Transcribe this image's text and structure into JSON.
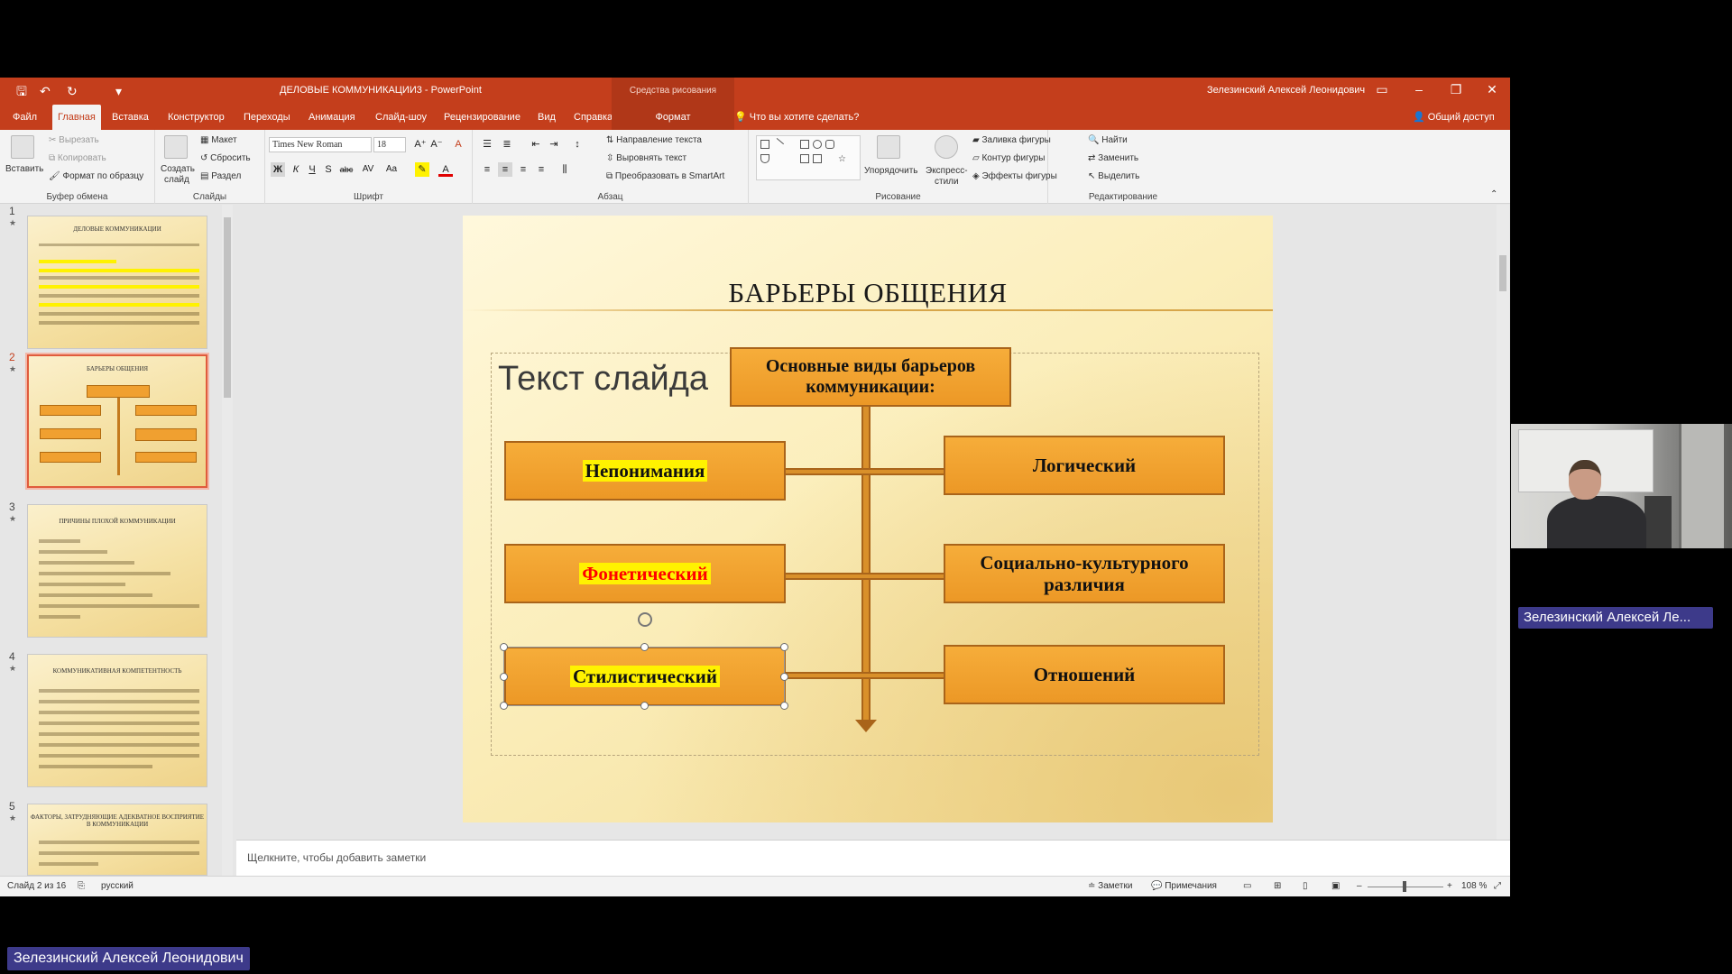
{
  "window": {
    "title": "ДЕЛОВЫЕ КОММУНИКАЦИИ3  -  PowerPoint",
    "context_group": "Средства рисования",
    "user": "Зелезинский Алексей Леонидович",
    "controls": {
      "ribbon_display": "▭",
      "minimize": "–",
      "restore": "❐",
      "close": "✕"
    }
  },
  "quick_access": {
    "save": "🖫",
    "undo": "↶",
    "redo": "↻",
    "customize": "▾"
  },
  "tabs": [
    "Файл",
    "Главная",
    "Вставка",
    "Конструктор",
    "Переходы",
    "Анимация",
    "Слайд-шоу",
    "Рецензирование",
    "Вид",
    "Справка",
    "Формат"
  ],
  "active_tab": "Главная",
  "tell_me": "Что вы хотите сделать?",
  "share": "Общий доступ",
  "ribbon": {
    "clipboard": {
      "paste": "Вставить",
      "cut": "Вырезать",
      "copy": "Копировать",
      "format_painter": "Формат по образцу",
      "label": "Буфер обмена"
    },
    "slides": {
      "new_slide_1": "Создать",
      "new_slide_2": "слайд",
      "layout": "Макет",
      "reset": "Сбросить",
      "section": "Раздел",
      "label": "Слайды"
    },
    "font": {
      "name": "Times New Roman",
      "size": "18",
      "bold": "Ж",
      "italic": "К",
      "underline": "Ч",
      "shadow": "S",
      "strike": "abc",
      "spacing": "AV",
      "case": "Aa",
      "color": "A",
      "grow": "A⁺",
      "shrink": "A⁻",
      "clear": "A",
      "label": "Шрифт"
    },
    "paragraph": {
      "text_direction": "Направление текста",
      "align_text": "Выровнять текст",
      "smartart": "Преобразовать в SmartArt",
      "label": "Абзац"
    },
    "drawing": {
      "arrange": "Упорядочить",
      "quick_styles_1": "Экспресс-",
      "quick_styles_2": "стили",
      "fill": "Заливка фигуры",
      "outline": "Контур фигуры",
      "effects": "Эффекты фигуры",
      "label": "Рисование"
    },
    "editing": {
      "find": "Найти",
      "replace": "Заменить",
      "select": "Выделить",
      "label": "Редактирование"
    }
  },
  "thumbnails": [
    {
      "num": "1",
      "title": "ДЕЛОВЫЕ КОММУНИКАЦИИ"
    },
    {
      "num": "2",
      "title": "БАРЬЕРЫ ОБЩЕНИЯ",
      "selected": true
    },
    {
      "num": "3",
      "title": "ПРИЧИНЫ ПЛОХОЙ КОММУНИКАЦИИ"
    },
    {
      "num": "4",
      "title": "КОММУНИКАТИВНАЯ КОМПЕТЕНТНОСТЬ"
    },
    {
      "num": "5",
      "title": "ФАКТОРЫ, ЗАТРУДНЯЮЩИЕ АДЕКВАТНОЕ ВОСПРИЯТИЕ В КОММУНИКАЦИИ"
    }
  ],
  "thumb_star": "★",
  "slide": {
    "title": "БАРЬЕРЫ ОБЩЕНИЯ",
    "placeholder": "Текст слайда",
    "header_box": "Основные виды барьеров коммуникации:",
    "left_boxes": [
      "Непонимания",
      "Фонетический",
      "Стилистический"
    ],
    "right_boxes": [
      "Логический",
      "Социально-культурного различия",
      "Отношений"
    ]
  },
  "notes_placeholder": "Щелкните, чтобы добавить заметки",
  "status": {
    "slide_of": "Слайд 2 из 16",
    "language": "русский",
    "notes": "Заметки",
    "comments": "Примечания",
    "zoom": "108 %"
  },
  "webcam_label": "Зелезинский Алексей Ле...",
  "participant_label": "Зелезинский Алексей Леонидович"
}
